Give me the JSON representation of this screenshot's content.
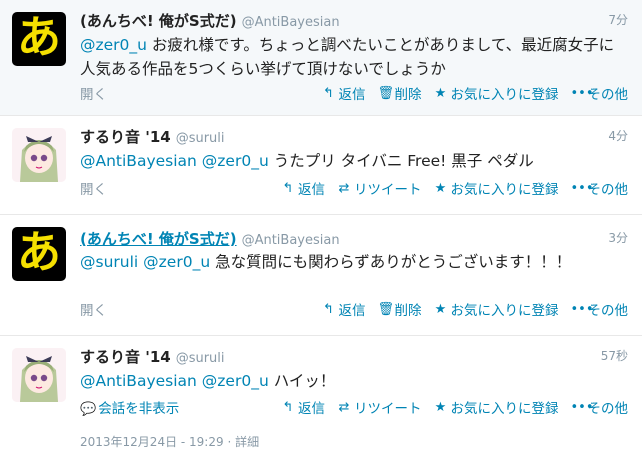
{
  "tweets": [
    {
      "name": "(あんちべ! 俺がS式だ)",
      "handle": "@AntiBayesian",
      "time": "7分",
      "mention": "@zer0_u",
      "text": " お疲れ様です。ちょっと調べたいことがありまして、最近腐女子に人気ある作品を5つくらい挙げて頂けないでしょうか",
      "open": "開く",
      "actions": {
        "reply": "返信",
        "delete": "削除",
        "favorite": "お気に入りに登録",
        "more": "その他"
      }
    },
    {
      "name": "するり音 '14",
      "handle": "@suruli",
      "time": "4分",
      "mention1": "@AntiBayesian",
      "mention2": "@zer0_u",
      "text": " うたプリ タイバニ Free! 黒子 ペダル",
      "open": "開く",
      "actions": {
        "reply": "返信",
        "retweet": "リツイート",
        "favorite": "お気に入りに登録",
        "more": "その他"
      }
    },
    {
      "name": "(あんちべ! 俺がS式だ)",
      "handle": "@AntiBayesian",
      "time": "3分",
      "mention1": "@suruli",
      "mention2": "@zer0_u",
      "text": " 急な質問にも関わらずありがとうございます！！！",
      "open": "開く",
      "actions": {
        "reply": "返信",
        "delete": "削除",
        "favorite": "お気に入りに登録",
        "more": "その他"
      }
    },
    {
      "name": "するり音 '14",
      "handle": "@suruli",
      "time": "57秒",
      "mention1": "@AntiBayesian",
      "mention2": "@zer0_u",
      "text": " ハイッ！",
      "conversation": "会話を非表示",
      "actions": {
        "reply": "返信",
        "retweet": "リツイート",
        "favorite": "お気に入りに登録",
        "more": "その他"
      }
    }
  ],
  "footer": {
    "date": "2013年12月24日 - 19:29",
    "sep": " · ",
    "details": "詳細"
  },
  "avatar_glyph": "あ",
  "colors": {
    "link": "#0084b4",
    "muted": "#8899a6",
    "avatar_bg": "#000000",
    "avatar_glyph": "#f5e000"
  },
  "icons": {
    "reply": "reply-arrow-icon",
    "delete": "trash-icon",
    "retweet": "retweet-icon",
    "favorite": "star-icon",
    "more": "dots-icon",
    "conversation": "speech-bubble-icon"
  }
}
